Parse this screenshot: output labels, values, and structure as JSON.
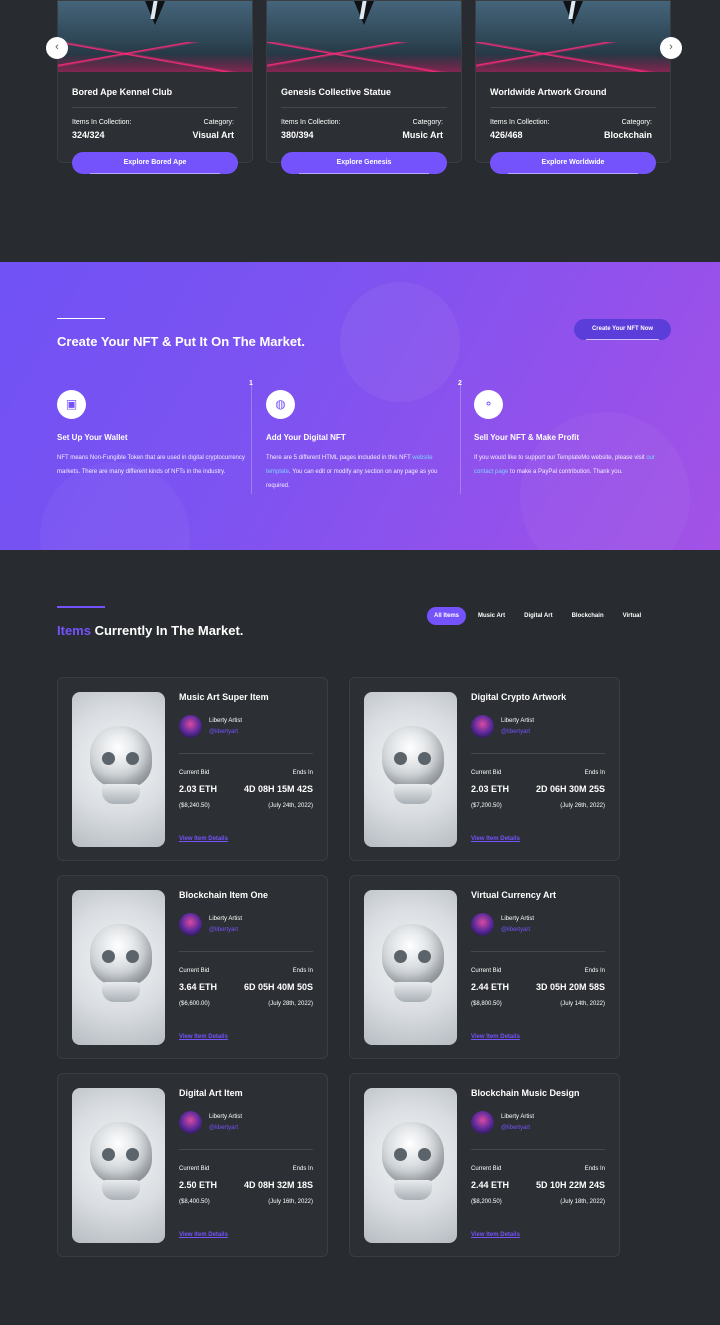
{
  "collections": [
    {
      "name": "Bored Ape Kennel Club",
      "items_label": "Items In Collection:",
      "items": "324/324",
      "category_label": "Category:",
      "category": "Visual Art",
      "button": "Explore Bored Ape"
    },
    {
      "name": "Genesis Collective Statue",
      "items_label": "Items In Collection:",
      "items": "380/394",
      "category_label": "Category:",
      "category": "Music Art",
      "button": "Explore Genesis"
    },
    {
      "name": "Worldwide Artwork Ground",
      "items_label": "Items In Collection:",
      "items": "426/468",
      "category_label": "Category:",
      "category": "Blockchain",
      "button": "Explore Worldwide"
    }
  ],
  "carousel": {
    "prev": "‹",
    "next": "›"
  },
  "banner": {
    "title": "Create Your NFT & Put It On The Market.",
    "cta": "Create Your NFT Now",
    "steps": [
      {
        "num": "",
        "icon": "wallet-icon",
        "title": "Set Up Your Wallet",
        "text": "NFT means Non-Fungible Token that are used in digital cryptocurrency markets. There are many different kinds of NFTs in the industry."
      },
      {
        "num": "1",
        "icon": "globe-icon",
        "title": "Add Your Digital NFT",
        "text_a": "There are 5 different HTML pages included in this NFT ",
        "link": "website template",
        "text_b": ". You can edit or modify any section on any page as you required."
      },
      {
        "num": "2",
        "icon": "coins-icon",
        "title": "Sell Your NFT & Make Profit",
        "text_a": "If you would like to support our TemplateMo website, please visit ",
        "link": "our contact page",
        "text_b": " to make a PayPal contribution. Thank you."
      }
    ]
  },
  "market": {
    "title_highlight": "Items",
    "title_rest": " Currently In The Market.",
    "filters": [
      "All Items",
      "Music Art",
      "Digital Art",
      "Blockchain",
      "Virtual"
    ],
    "active_filter": "All Items",
    "items": [
      {
        "title": "Music Art Super Item",
        "artist": "Liberty Artist",
        "handle": "@libertyart",
        "bid_label": "Current Bid",
        "ends_label": "Ends In",
        "bid": "2.03 ETH",
        "ends": "4D 08H 15M 42S",
        "usd": "($8,240.50)",
        "date": "(July 24th, 2022)",
        "link": "View Item Details"
      },
      {
        "title": "Digital Crypto Artwork",
        "artist": "Liberty Artist",
        "handle": "@libertyart",
        "bid_label": "Current Bid",
        "ends_label": "Ends In",
        "bid": "2.03 ETH",
        "ends": "2D 06H 30M 25S",
        "usd": "($7,200.50)",
        "date": "(July 26th, 2022)",
        "link": "View Item Details"
      },
      {
        "title": "Blockchain Item One",
        "artist": "Liberty Artist",
        "handle": "@libertyart",
        "bid_label": "Current Bid",
        "ends_label": "Ends In",
        "bid": "3.64 ETH",
        "ends": "6D 05H 40M 50S",
        "usd": "($6,600.00)",
        "date": "(July 28th, 2022)",
        "link": "View Item Details"
      },
      {
        "title": "Virtual Currency Art",
        "artist": "Liberty Artist",
        "handle": "@libertyart",
        "bid_label": "Current Bid",
        "ends_label": "Ends In",
        "bid": "2.44 ETH",
        "ends": "3D 05H 20M 58S",
        "usd": "($8,800.50)",
        "date": "(July 14th, 2022)",
        "link": "View Item Details"
      },
      {
        "title": "Digital Art Item",
        "artist": "Liberty Artist",
        "handle": "@libertyart",
        "bid_label": "Current Bid",
        "ends_label": "Ends In",
        "bid": "2.50 ETH",
        "ends": "4D 08H 32M 18S",
        "usd": "($8,400.50)",
        "date": "(July 16th, 2022)",
        "link": "View Item Details"
      },
      {
        "title": "Blockchain Music Design",
        "artist": "Liberty Artist",
        "handle": "@libertyart",
        "bid_label": "Current Bid",
        "ends_label": "Ends In",
        "bid": "2.44 ETH",
        "ends": "5D 10H 22M 24S",
        "usd": "($8,200.50)",
        "date": "(July 18th, 2022)",
        "link": "View Item Details"
      }
    ]
  },
  "colors": {
    "accent": "#7453fc",
    "background": "#282b2f",
    "card": "#2c2f33"
  }
}
